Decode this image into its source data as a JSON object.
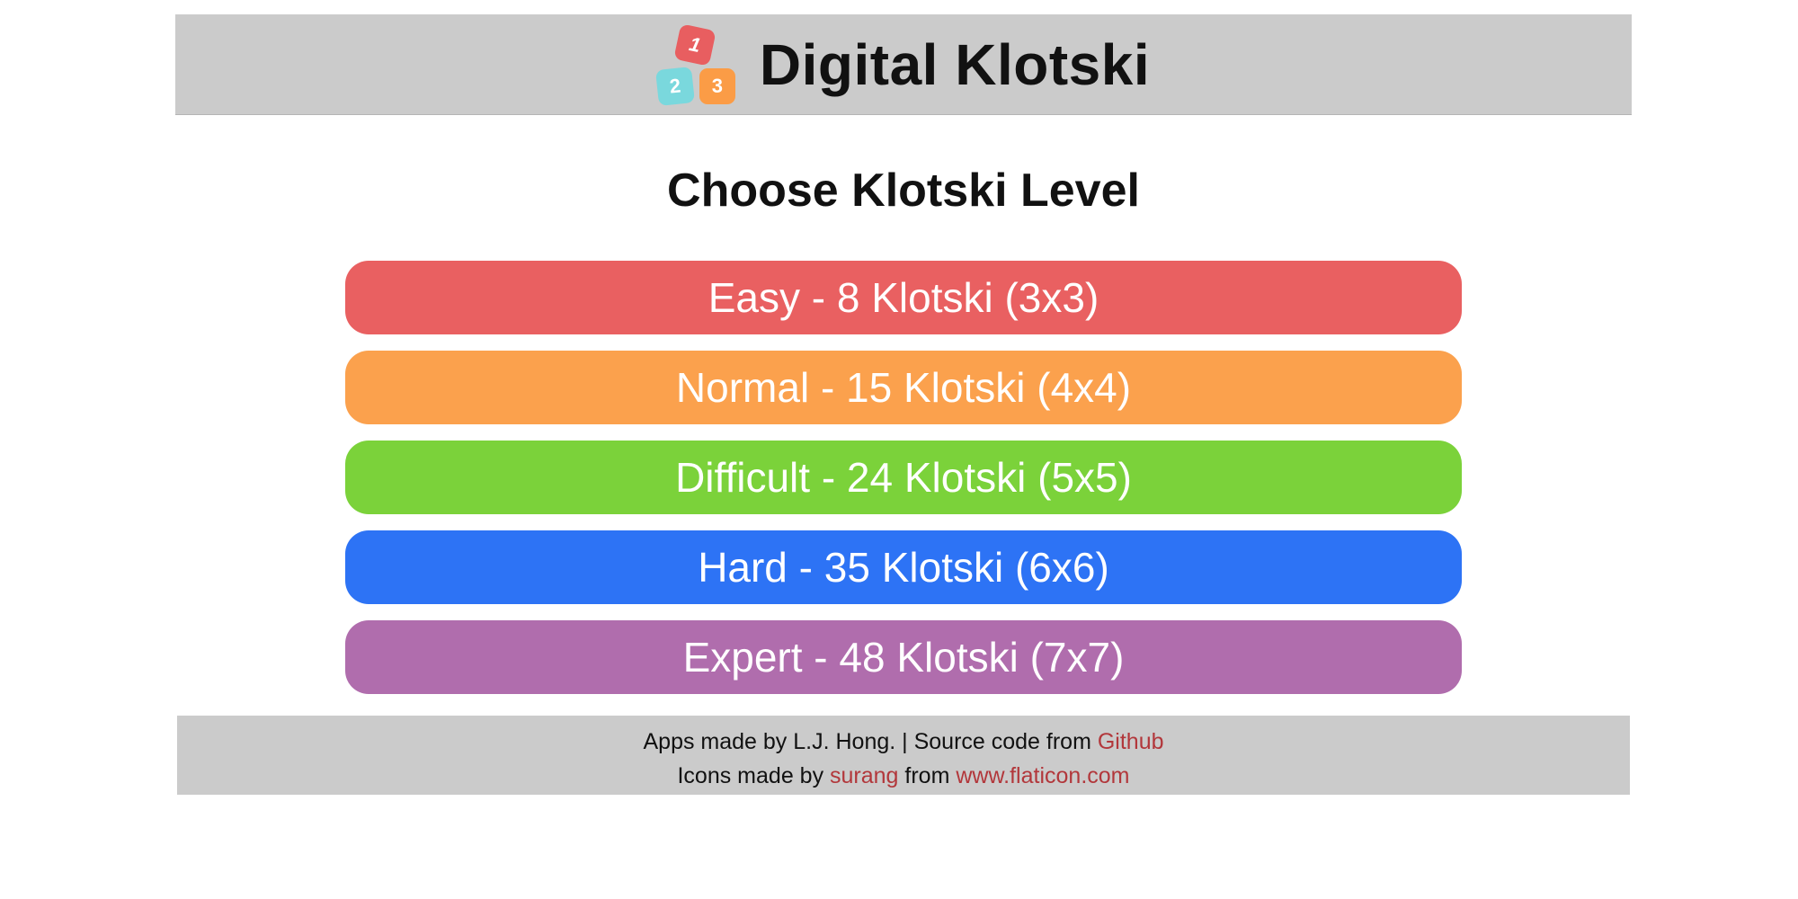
{
  "header": {
    "title": "Digital Klotski",
    "logo": {
      "icon": "numbered-cubes-icon",
      "cubes": [
        "1",
        "2",
        "3"
      ],
      "colors": [
        "#e85e60",
        "#7ad8dd",
        "#fb9c46"
      ]
    },
    "background": "#cbcbcb"
  },
  "main": {
    "heading": "Choose Klotski Level",
    "levels": [
      {
        "label": "Easy - 8 Klotski (3x3)",
        "color": "#e96061"
      },
      {
        "label": "Normal - 15 Klotski (4x4)",
        "color": "#fba14d"
      },
      {
        "label": "Difficult - 24 Klotski (5x5)",
        "color": "#7bd23a"
      },
      {
        "label": "Hard - 35 Klotski (6x6)",
        "color": "#2d73f5"
      },
      {
        "label": "Expert - 48 Klotski (7x7)",
        "color": "#b06dad"
      }
    ]
  },
  "footer": {
    "line1_prefix": "Apps made by L.J. Hong. | Source code from ",
    "github_link": "Github",
    "line2_prefix": "Icons made by ",
    "surang_link": "surang",
    "line2_middle": " from ",
    "flaticon_link": "www.flaticon.com",
    "link_color": "#b2373b"
  }
}
